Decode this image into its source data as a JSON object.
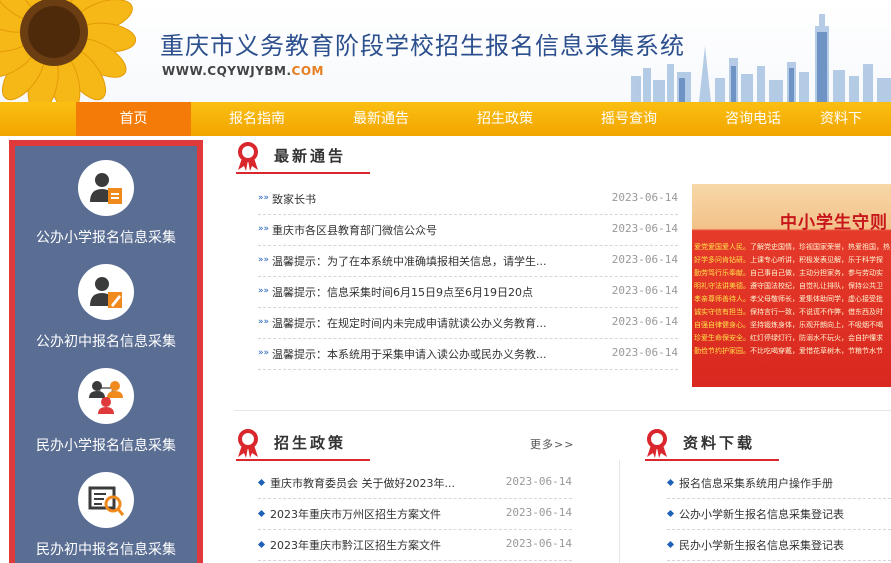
{
  "header": {
    "title": "重庆市义务教育阶段学校招生报名信息采集系统",
    "url_prefix": "WWW.CQYWJYBM.",
    "url_suffix": "COM"
  },
  "nav": {
    "items": [
      "首页",
      "报名指南",
      "最新通告",
      "招生政策",
      "摇号查询",
      "咨询电话",
      "资料下"
    ],
    "active_index": 0
  },
  "sidebar": {
    "items": [
      {
        "label": "公办小学报名信息采集",
        "icon": "user-document-icon"
      },
      {
        "label": "公办初中报名信息采集",
        "icon": "user-edit-icon"
      },
      {
        "label": "民办小学报名信息采集",
        "icon": "network-users-icon"
      },
      {
        "label": "民办初中报名信息采集",
        "icon": "form-search-icon"
      }
    ]
  },
  "notices": {
    "title": "最新通告",
    "items": [
      {
        "text": "致家长书",
        "date": "2023-06-14"
      },
      {
        "text": "重庆市各区县教育部门微信公众号",
        "date": "2023-06-14"
      },
      {
        "text": "温馨提示：为了在本系统中准确填报相关信息，请学生...",
        "date": "2023-06-14"
      },
      {
        "text": "温馨提示：信息采集时间6月15日9点至6月19日20点",
        "date": "2023-06-14"
      },
      {
        "text": "温馨提示：在规定时间内未完成申请就读公办义务教育...",
        "date": "2023-06-14"
      },
      {
        "text": "温馨提示：本系统用于采集申请入读公办或民办义务教...",
        "date": "2023-06-14"
      }
    ]
  },
  "poster": {
    "title": "中小学生守则",
    "lines": [
      {
        "head": "爱党爱国爱人民。",
        "body": "了解党史国情，珍视国家荣誉，热爱祖国，热"
      },
      {
        "head": "好学多问肯钻研。",
        "body": "上课专心听讲，积极发表见解，乐于科学探"
      },
      {
        "head": "勤劳笃行乐奉献。",
        "body": "自己事自己做，主动分担家务，参与劳动实"
      },
      {
        "head": "明礼守法讲美德。",
        "body": "遵守国法校纪，自觉礼让排队，保持公共卫"
      },
      {
        "head": "孝亲尊师善待人。",
        "body": "孝父母敬师长，爱集体助同学，虚心接受批"
      },
      {
        "head": "诚实守信有担当。",
        "body": "保持言行一致，不说谎不作弊，借东西及时"
      },
      {
        "head": "自强自律健身心。",
        "body": "坚持锻炼身体，乐观开朗向上，不吸烟不喝"
      },
      {
        "head": "珍爱生命保安全。",
        "body": "红灯停绿灯行，防溺水不玩火，会自护懂求"
      },
      {
        "head": "勤俭节约护家园。",
        "body": "不比吃喝穿戴，爱惜花草树木，节粮节水节"
      }
    ]
  },
  "policy": {
    "title": "招生政策",
    "more_label": "更多>>",
    "items": [
      {
        "text": "重庆市教育委员会 关于做好2023年...",
        "date": "2023-06-14"
      },
      {
        "text": "2023年重庆市万州区招生方案文件",
        "date": "2023-06-14"
      },
      {
        "text": "2023年重庆市黔江区招生方案文件",
        "date": "2023-06-14"
      }
    ]
  },
  "downloads": {
    "title": "资料下载",
    "items": [
      {
        "text": "报名信息采集系统用户操作手册"
      },
      {
        "text": "公办小学新生报名信息采集登记表"
      },
      {
        "text": "民办小学新生报名信息采集登记表"
      }
    ]
  },
  "colors": {
    "nav_bg": "#f7b10a",
    "nav_active": "#f47b07",
    "sidebar_bg": "#5a6e94",
    "sidebar_border": "#e0393b",
    "title_blue": "#2c4f8e",
    "accent_red": "#d9272d"
  }
}
